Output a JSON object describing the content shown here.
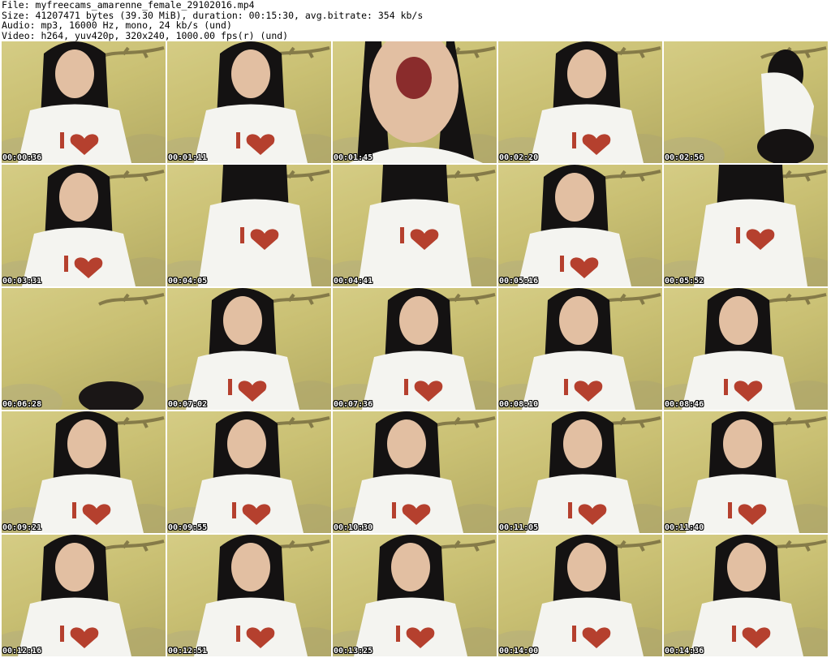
{
  "header": {
    "lines": [
      "File: myfreecams_amarenne_female_29102016.mp4",
      "Size: 41207471 bytes (39.30 MiB), duration: 00:15:30, avg.bitrate: 354 kb/s",
      "Audio: mp3, 16000 Hz, mono, 24 kb/s (und)",
      "Video: h264, yuv420p, 320x240, 1000.00 fps(r) (und)"
    ]
  },
  "thumbnails": [
    {
      "time": "00:00:36",
      "scene": "portrait-shirt"
    },
    {
      "time": "00:01:11",
      "scene": "portrait-shirt"
    },
    {
      "time": "00:01:45",
      "scene": "closeup-face"
    },
    {
      "time": "00:02:20",
      "scene": "portrait-shirt"
    },
    {
      "time": "00:02:56",
      "scene": "side-pose"
    },
    {
      "time": "00:03:31",
      "scene": "portrait-shirt"
    },
    {
      "time": "00:04:05",
      "scene": "torso-shirt"
    },
    {
      "time": "00:04:41",
      "scene": "torso-shirt"
    },
    {
      "time": "00:05:16",
      "scene": "portrait-shirt"
    },
    {
      "time": "00:05:52",
      "scene": "torso-shirt"
    },
    {
      "time": "00:06:28",
      "scene": "wall-empty"
    },
    {
      "time": "00:07:02",
      "scene": "portrait-shirt"
    },
    {
      "time": "00:07:36",
      "scene": "portrait-shirt"
    },
    {
      "time": "00:08:10",
      "scene": "portrait-shirt"
    },
    {
      "time": "00:08:46",
      "scene": "portrait-shirt"
    },
    {
      "time": "00:09:21",
      "scene": "portrait-shirt"
    },
    {
      "time": "00:09:55",
      "scene": "portrait-shirt"
    },
    {
      "time": "00:10:30",
      "scene": "portrait-shirt"
    },
    {
      "time": "00:11:05",
      "scene": "portrait-shirt"
    },
    {
      "time": "00:11:40",
      "scene": "portrait-shirt"
    },
    {
      "time": "00:12:16",
      "scene": "portrait-shirt"
    },
    {
      "time": "00:12:51",
      "scene": "portrait-shirt"
    },
    {
      "time": "00:13:25",
      "scene": "portrait-shirt"
    },
    {
      "time": "00:14:00",
      "scene": "portrait-shirt"
    },
    {
      "time": "00:14:36",
      "scene": "portrait-shirt"
    }
  ],
  "colors": {
    "wall": "#cfc57c",
    "shirt": "#f4f4f0",
    "hair": "#141212",
    "skin": "#e2bfa2",
    "heart": "#b5402e",
    "timestamp_text": "#ffffff"
  }
}
